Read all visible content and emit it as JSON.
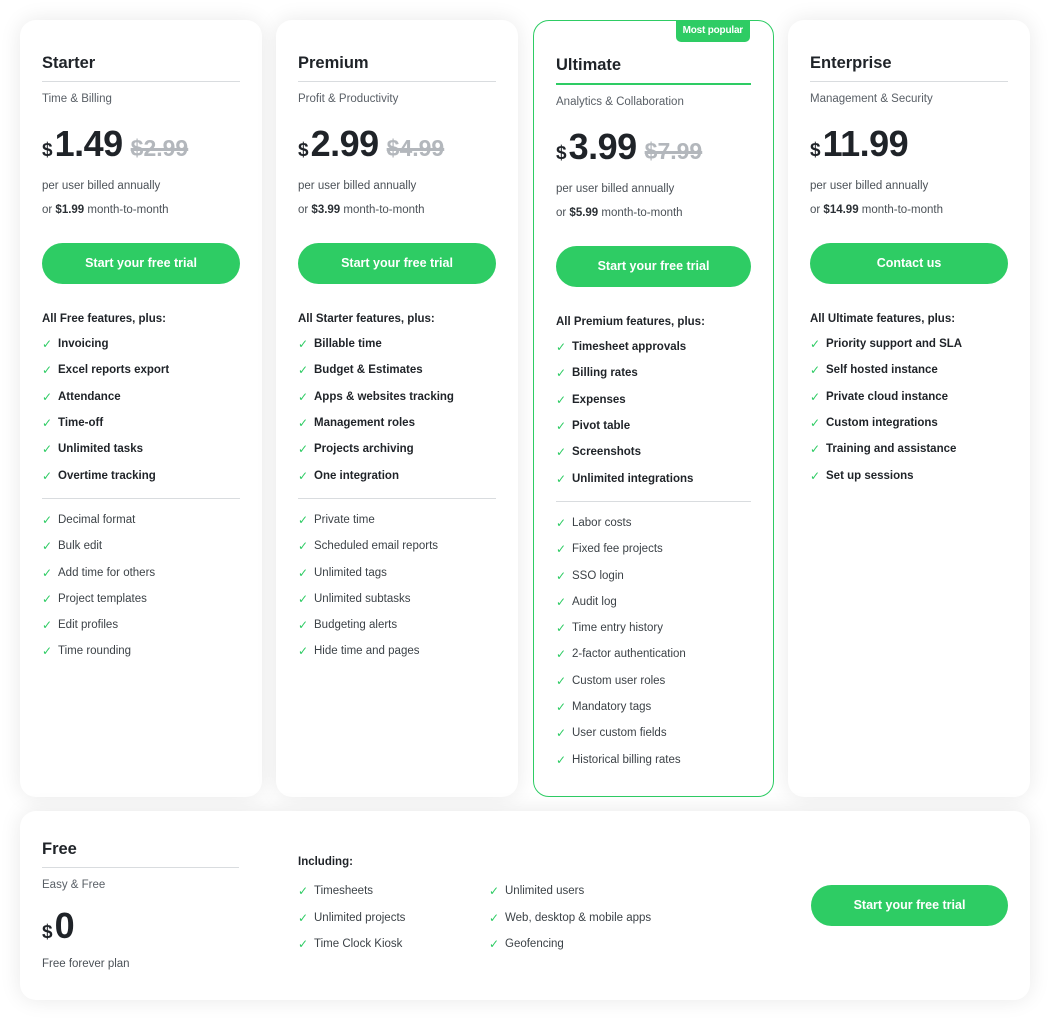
{
  "colors": {
    "accent": "#2ecc64",
    "text": "#1f2328",
    "muted": "#595f66",
    "strike": "#b3b7bc"
  },
  "icons": {
    "check": "check-icon"
  },
  "plans": [
    {
      "name": "Starter",
      "subtitle": "Time & Billing",
      "currency": "$",
      "price": "1.49",
      "old_price": "$2.99",
      "billed": "per user billed annually",
      "monthly_prefix": "or ",
      "monthly_price": "$1.99",
      "monthly_suffix": " month-to-month",
      "cta": "Start your free trial",
      "features_heading": "All Free features, plus:",
      "features_main": [
        "Invoicing",
        "Excel reports export",
        "Attendance",
        "Time-off",
        "Unlimited tasks",
        "Overtime tracking"
      ],
      "features_extra": [
        "Decimal format",
        "Bulk edit",
        "Add time for others",
        "Project templates",
        "Edit profiles",
        "Time rounding"
      ]
    },
    {
      "name": "Premium",
      "subtitle": "Profit & Productivity",
      "currency": "$",
      "price": "2.99",
      "old_price": "$4.99",
      "billed": "per user billed annually",
      "monthly_prefix": "or ",
      "monthly_price": "$3.99",
      "monthly_suffix": " month-to-month",
      "cta": "Start your free trial",
      "features_heading": "All Starter features, plus:",
      "features_main": [
        "Billable time",
        "Budget & Estimates",
        "Apps & websites tracking",
        "Management roles",
        "Projects archiving",
        "One integration"
      ],
      "features_extra": [
        "Private time",
        "Scheduled email reports",
        "Unlimited tags",
        "Unlimited subtasks",
        "Budgeting alerts",
        "Hide time and pages"
      ]
    },
    {
      "name": "Ultimate",
      "badge": "Most popular",
      "subtitle": "Analytics & Collaboration",
      "currency": "$",
      "price": "3.99",
      "old_price": "$7.99",
      "billed": "per user billed annually",
      "monthly_prefix": "or ",
      "monthly_price": "$5.99",
      "monthly_suffix": " month-to-month",
      "cta": "Start your free trial",
      "features_heading": "All Premium features, plus:",
      "features_main": [
        "Timesheet approvals",
        "Billing rates",
        "Expenses",
        "Pivot table",
        "Screenshots",
        "Unlimited integrations"
      ],
      "features_extra": [
        "Labor costs",
        "Fixed fee projects",
        "SSO login",
        "Audit log",
        "Time entry history",
        "2-factor authentication",
        "Custom user roles",
        "Mandatory tags",
        "User custom fields",
        "Historical billing rates"
      ]
    },
    {
      "name": "Enterprise",
      "subtitle": "Management & Security",
      "currency": "$",
      "price": "11.99",
      "old_price": "",
      "billed": "per user billed annually",
      "monthly_prefix": "or ",
      "monthly_price": "$14.99",
      "monthly_suffix": " month-to-month",
      "cta": "Contact us",
      "features_heading": "All Ultimate features, plus:",
      "features_main": [
        "Priority support and SLA",
        "Self hosted instance",
        "Private cloud instance",
        "Custom integrations",
        "Training and assistance",
        "Set up sessions"
      ],
      "features_extra": []
    }
  ],
  "free": {
    "name": "Free",
    "subtitle": "Easy & Free",
    "currency": "$",
    "price": "0",
    "note": "Free forever plan",
    "including_heading": "Including:",
    "features_col1": [
      "Timesheets",
      "Unlimited projects",
      "Time Clock Kiosk"
    ],
    "features_col2": [
      "Unlimited users",
      "Web, desktop & mobile apps",
      "Geofencing"
    ],
    "cta": "Start your free trial"
  }
}
